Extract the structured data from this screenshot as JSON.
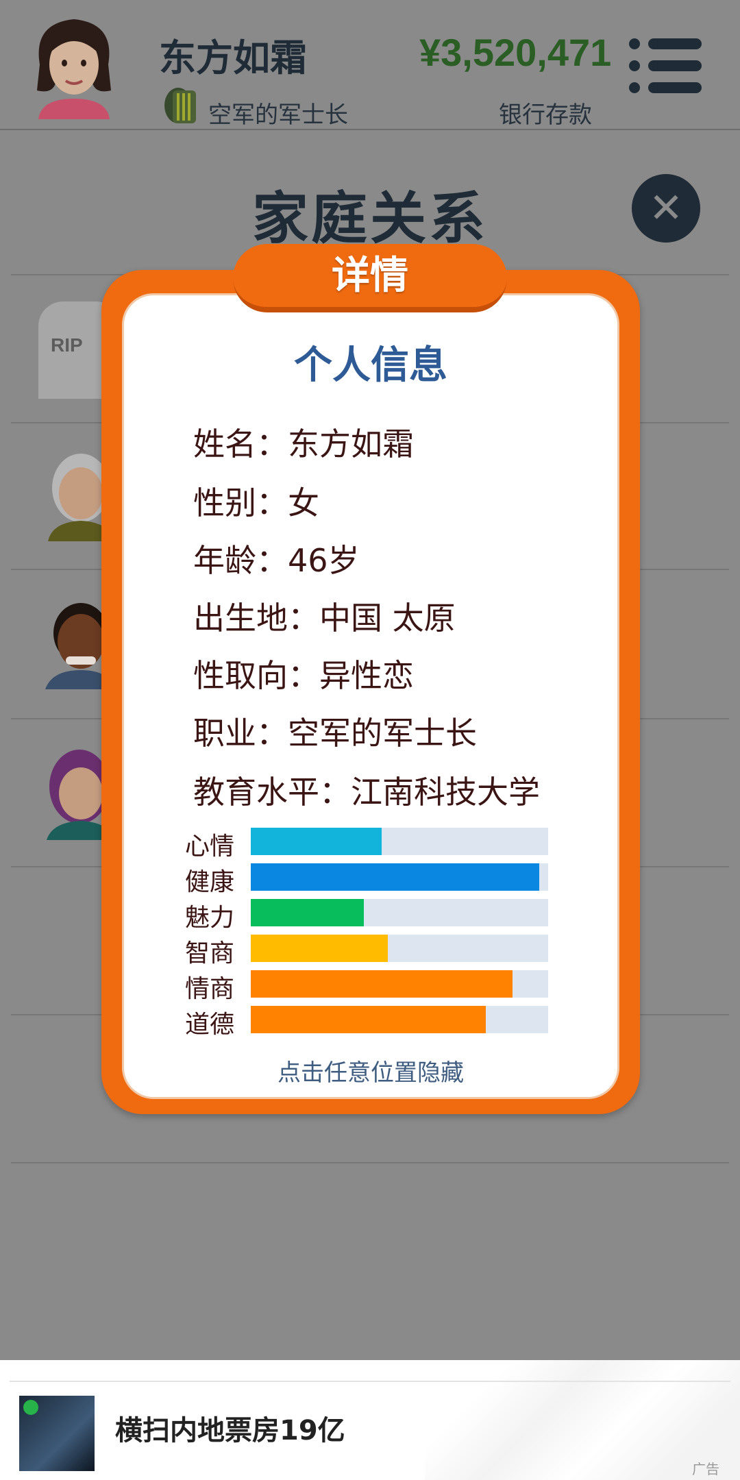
{
  "header": {
    "player_name": "东方如霜",
    "job": "空军的军士长",
    "money": "¥3,520,471",
    "money_label": "银行存款"
  },
  "page": {
    "title": "家庭关系",
    "tombstone_text": "RIP"
  },
  "modal": {
    "tab_label": "详情",
    "section_title": "个人信息",
    "rows": [
      {
        "label": "姓名：",
        "value": "东方如霜"
      },
      {
        "label": "性别：",
        "value": "女"
      },
      {
        "label": "年龄：",
        "value": "46岁"
      },
      {
        "label": "出生地：",
        "value": "中国 太原"
      },
      {
        "label": "性取向：",
        "value": "异性恋"
      },
      {
        "label": "职业：",
        "value": "空军的军士长"
      },
      {
        "label": "教育水平：",
        "value": "江南科技大学"
      }
    ],
    "stats": [
      {
        "label": "心情",
        "value": 0.44,
        "color": "#12b4dc"
      },
      {
        "label": "健康",
        "value": 0.97,
        "color": "#0a87e0"
      },
      {
        "label": "魅力",
        "value": 0.38,
        "color": "#07bd5c"
      },
      {
        "label": "智商",
        "value": 0.46,
        "color": "#ffbb00"
      },
      {
        "label": "情商",
        "value": 0.88,
        "color": "#ff8200"
      },
      {
        "label": "道德",
        "value": 0.79,
        "color": "#ff8200"
      }
    ],
    "hint": "点击任意位置隐藏"
  },
  "ad": {
    "text": "横扫内地票房19亿",
    "tag": "广告"
  },
  "colors": {
    "accent_orange": "#f06a10",
    "title_blue": "#2e5b95",
    "money_green": "#2a5e25"
  }
}
